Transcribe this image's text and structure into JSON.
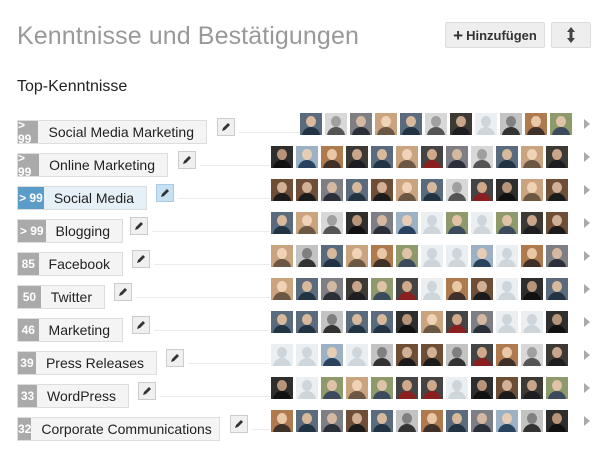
{
  "header": {
    "title": "Kenntnisse und Bestätigungen",
    "add_label": "Hinzufügen",
    "add_icon": "plus-icon",
    "sort_icon": "up-down-arrows-icon"
  },
  "section": {
    "title": "Top-Kenntnisse"
  },
  "colors": {
    "count_badge": "#aaaaaa",
    "highlight_badge": "#5b9cc9",
    "highlight_edit": "#c5e1f2"
  },
  "skills": [
    {
      "count": "> 99",
      "name": "Social Media Marketing"
    },
    {
      "count": "> 99",
      "name": "Online Marketing"
    },
    {
      "count": "> 99",
      "name": "Social Media"
    },
    {
      "count": "> 99",
      "name": "Blogging"
    },
    {
      "count": "85",
      "name": "Facebook"
    },
    {
      "count": "50",
      "name": "Twitter"
    },
    {
      "count": "46",
      "name": "Marketing"
    },
    {
      "count": "39",
      "name": "Press Releases"
    },
    {
      "count": "33",
      "name": "WordPress"
    },
    {
      "count": "32",
      "name": "Corporate Communications"
    }
  ]
}
